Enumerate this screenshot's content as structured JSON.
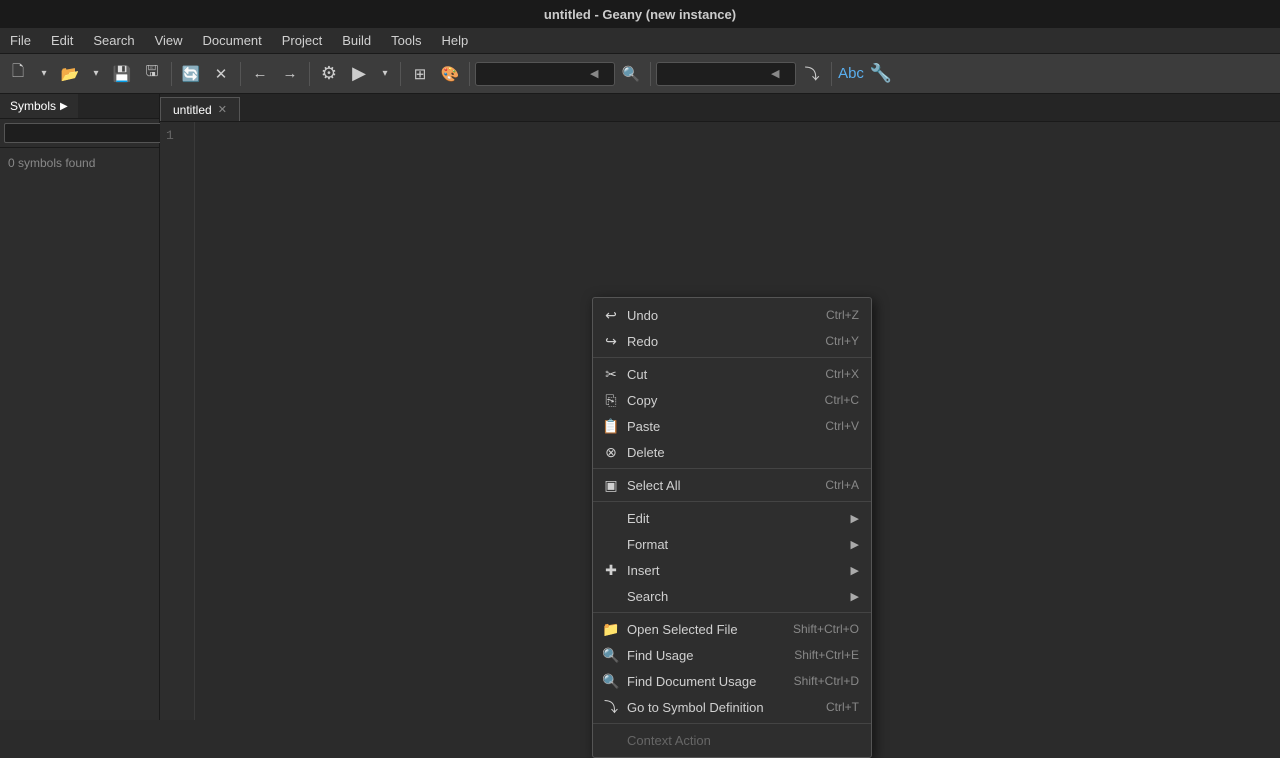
{
  "titlebar": {
    "text": "untitled - Geany (new instance)"
  },
  "menubar": {
    "items": [
      {
        "label": "File"
      },
      {
        "label": "Edit"
      },
      {
        "label": "Search"
      },
      {
        "label": "View"
      },
      {
        "label": "Document"
      },
      {
        "label": "Project"
      },
      {
        "label": "Build"
      },
      {
        "label": "Tools"
      },
      {
        "label": "Help"
      }
    ]
  },
  "sidebar": {
    "tab_symbols": "Symbols",
    "tab_chevron": "▶",
    "no_symbols_text": "0 symbols found"
  },
  "tabs": {
    "active_tab": "untitled"
  },
  "editor": {
    "line_number": "1"
  },
  "context_menu": {
    "items": [
      {
        "id": "undo",
        "icon": "↩",
        "label": "Undo",
        "shortcut": "Ctrl+Z",
        "type": "item"
      },
      {
        "id": "redo",
        "icon": "↪",
        "label": "Redo",
        "shortcut": "Ctrl+Y",
        "type": "item"
      },
      {
        "id": "sep1",
        "type": "separator"
      },
      {
        "id": "cut",
        "icon": "✂",
        "label": "Cut",
        "shortcut": "Ctrl+X",
        "type": "item"
      },
      {
        "id": "copy",
        "icon": "⎘",
        "label": "Copy",
        "shortcut": "Ctrl+C",
        "type": "item"
      },
      {
        "id": "paste",
        "icon": "📋",
        "label": "Paste",
        "shortcut": "Ctrl+V",
        "type": "item"
      },
      {
        "id": "delete",
        "icon": "⊗",
        "label": "Delete",
        "shortcut": "",
        "type": "item"
      },
      {
        "id": "sep2",
        "type": "separator"
      },
      {
        "id": "selectall",
        "icon": "▣",
        "label": "Select All",
        "shortcut": "Ctrl+A",
        "type": "item"
      },
      {
        "id": "sep3",
        "type": "separator"
      },
      {
        "id": "edit",
        "icon": "",
        "label": "Edit",
        "shortcut": "",
        "type": "submenu"
      },
      {
        "id": "format",
        "icon": "",
        "label": "Format",
        "shortcut": "",
        "type": "submenu"
      },
      {
        "id": "insert",
        "icon": "✚",
        "label": "Insert",
        "shortcut": "",
        "type": "submenu"
      },
      {
        "id": "search",
        "icon": "",
        "label": "Search",
        "shortcut": "",
        "type": "submenu"
      },
      {
        "id": "sep4",
        "type": "separator"
      },
      {
        "id": "openfile",
        "icon": "📁",
        "label": "Open Selected File",
        "shortcut": "Shift+Ctrl+O",
        "type": "item"
      },
      {
        "id": "findusage",
        "icon": "🔍",
        "label": "Find Usage",
        "shortcut": "Shift+Ctrl+E",
        "type": "item"
      },
      {
        "id": "finddoc",
        "icon": "🔍",
        "label": "Find Document Usage",
        "shortcut": "Shift+Ctrl+D",
        "type": "item"
      },
      {
        "id": "gotosym",
        "icon": "⤵",
        "label": "Go to Symbol Definition",
        "shortcut": "Ctrl+T",
        "type": "item"
      },
      {
        "id": "sep5",
        "type": "separator"
      },
      {
        "id": "context",
        "icon": "",
        "label": "Context Action",
        "shortcut": "",
        "type": "item",
        "disabled": true
      }
    ]
  }
}
